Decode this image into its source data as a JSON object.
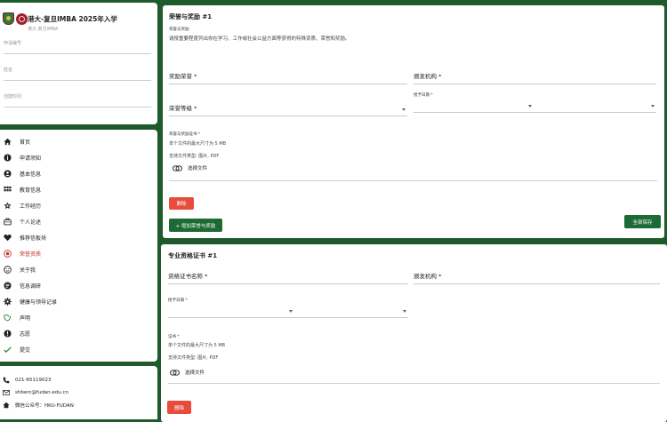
{
  "brand": {
    "title": "港大-复旦IMBA 2025年入学",
    "subtitle": "港大·复旦IMBA"
  },
  "applicant": {
    "app_no_label": "申请编号",
    "name_label": "姓名",
    "dob_label": "创建时间"
  },
  "nav": [
    {
      "label": "首页",
      "icon": "home-icon"
    },
    {
      "label": "申请须知",
      "icon": "info-icon"
    },
    {
      "label": "基本信息",
      "icon": "profile-icon"
    },
    {
      "label": "教育信息",
      "icon": "education-icon"
    },
    {
      "label": "工作经历",
      "icon": "work-icon"
    },
    {
      "label": "个人论述",
      "icon": "briefcase-icon"
    },
    {
      "label": "推荐信板块",
      "icon": "heart-icon"
    },
    {
      "label": "荣誉资质",
      "icon": "award-icon",
      "active": true
    },
    {
      "label": "关于我",
      "icon": "smile-icon"
    },
    {
      "label": "信息调研",
      "icon": "survey-icon"
    },
    {
      "label": "健康与领导记录",
      "icon": "gear-icon"
    },
    {
      "label": "声明",
      "icon": "leaf-icon"
    },
    {
      "label": "志愿",
      "icon": "alert-icon"
    },
    {
      "label": "提交",
      "icon": "check-icon"
    }
  ],
  "contact": {
    "phone": "021-65119023",
    "email": "shberc@fudan.edu.cn",
    "wechat": "微信公众号：HKU-FUDAN"
  },
  "colors": {
    "brand_green": "#1d6b34",
    "delete_red": "#e74c3c",
    "active_red": "#c0392b"
  },
  "honors": {
    "title": "荣誉与奖励 #1",
    "section_label": "荣誉与奖励",
    "description": "请按重要程度列出你在学习、工作或社会公益方面等获得的特殊资质、荣誉和奖励。",
    "award_label": "奖励荣誉 *",
    "issuer_label": "颁发机构 *",
    "level_label": "荣誉等级 *",
    "date_label": "授予日期 *",
    "cert_label": "荣誉与奖励证书 *",
    "max_size": "单个文件的最大尺寸为 5 MB",
    "types": "支持文件类型: 图片, PDF",
    "choose_file": "选择文件",
    "delete_button": "删除",
    "add_button": "+ 增加荣誉与奖励",
    "save_button": "全部保存"
  },
  "certs": {
    "title": "专业资格证书 #1",
    "name_label": "资格证书名称 *",
    "issuer_label": "颁发机构 *",
    "date_label": "授予日期 *",
    "cert_label": "证书 *",
    "max_size": "单个文件的最大尺寸为 5 MB",
    "types": "支持文件类型: 图片, PDF",
    "choose_file": "选择文件",
    "delete_button": "删除"
  }
}
